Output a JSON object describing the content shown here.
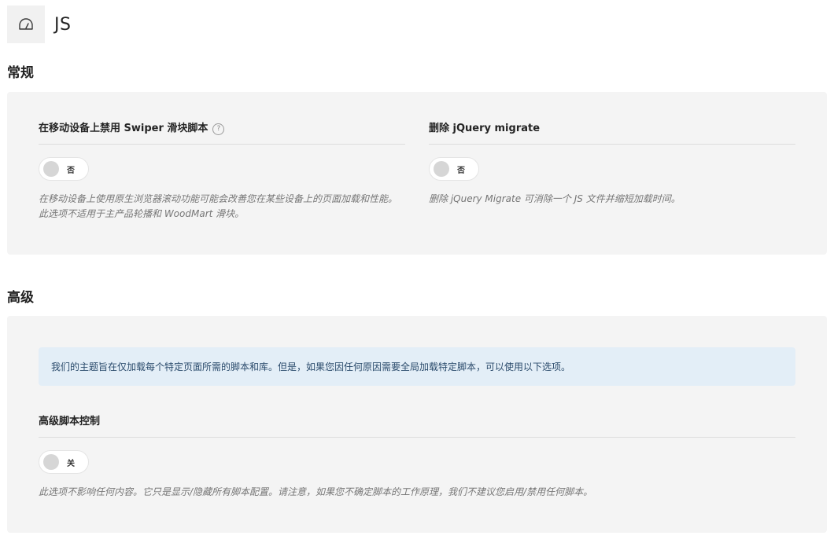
{
  "header": {
    "icon": "speedometer-icon",
    "title": "JS"
  },
  "sections": [
    {
      "heading": "常规",
      "options": [
        {
          "title": "在移动设备上禁用 Swiper 滑块脚本",
          "help_icon": "?",
          "toggle_value": "否",
          "toggle_on": false,
          "description": "在移动设备上使用原生浏览器滚动功能可能会改善您在某些设备上的页面加载和性能。此选项不适用于主产品轮播和 WoodMart 滑块。"
        },
        {
          "title": "删除 jQuery migrate",
          "toggle_value": "否",
          "toggle_on": false,
          "description": "删除 jQuery Migrate 可消除一个 JS 文件并缩短加载时间。"
        }
      ]
    },
    {
      "heading": "高级",
      "notice": "我们的主题旨在仅加载每个特定页面所需的脚本和库。但是，如果您因任何原因需要全局加载特定脚本，可以使用以下选项。",
      "options": [
        {
          "title": "高级脚本控制",
          "toggle_value": "关",
          "toggle_on": false,
          "description": "此选项不影响任何内容。它只是显示/隐藏所有脚本配置。请注意，如果您不确定脚本的工作原理，我们不建议您启用/禁用任何脚本。"
        }
      ]
    }
  ],
  "colors": {
    "panel_bg": "#f4f4f4",
    "notice_bg": "#e3eef7",
    "notice_text": "#2a4a6b",
    "toggle_knob_off": "#d6d6d6"
  }
}
